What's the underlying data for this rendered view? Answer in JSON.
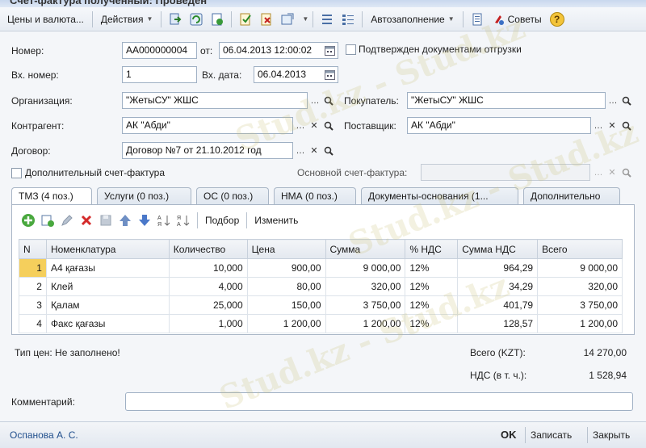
{
  "window": {
    "title": "Счет-фактура полученный: Проведен"
  },
  "toolbar": {
    "prices_label": "Цены и валюта...",
    "actions_label": "Действия",
    "autofill_label": "Автозаполнение",
    "tips_label": "Советы",
    "help_label": "?"
  },
  "form": {
    "number_label": "Номер:",
    "number_value": "АА000000004",
    "date_label": "от:",
    "date_value": "06.04.2013 12:00:02",
    "confirmed_label": "Подтвержден документами отгрузки",
    "in_number_label": "Вх. номер:",
    "in_number_value": "1",
    "in_date_label": "Вх. дата:",
    "in_date_value": "06.04.2013",
    "org_label": "Организация:",
    "org_value": "\"ЖетыСУ\" ЖШС",
    "buyer_label": "Покупатель:",
    "buyer_value": "\"ЖетыСУ\" ЖШС",
    "contractor_label": "Контрагент:",
    "contractor_value": "АК \"Абди\"",
    "supplier_label": "Поставщик:",
    "supplier_value": "АК \"Абди\"",
    "contract_label": "Договор:",
    "contract_value": "Договор №7 от 21.10.2012 год",
    "additional_label": "Дополнительный счет-фактура",
    "main_invoice_label": "Основной счет-фактура:",
    "main_invoice_value": ""
  },
  "tabs": [
    {
      "label": "ТМЗ (4 поз.)",
      "active": true
    },
    {
      "label": "Услуги (0 поз.)"
    },
    {
      "label": "ОС (0 поз.)"
    },
    {
      "label": "НМА (0 поз.)"
    },
    {
      "label": "Документы-основания (1..."
    },
    {
      "label": "Дополнительно"
    }
  ],
  "panel_toolbar": {
    "select_label": "Подбор",
    "change_label": "Изменить"
  },
  "table": {
    "headers": [
      "N",
      "Номенклатура",
      "Количество",
      "Цена",
      "Сумма",
      "% НДС",
      "Сумма НДС",
      "Всего"
    ],
    "rows": [
      [
        "1",
        "А4 қағазы",
        "10,000",
        "900,00",
        "9 000,00",
        "12%",
        "964,29",
        "9 000,00"
      ],
      [
        "2",
        "Клей",
        "4,000",
        "80,00",
        "320,00",
        "12%",
        "34,29",
        "320,00"
      ],
      [
        "3",
        "Қалам",
        "25,000",
        "150,00",
        "3 750,00",
        "12%",
        "401,79",
        "3 750,00"
      ],
      [
        "4",
        "Факс қағазы",
        "1,000",
        "1 200,00",
        "1 200,00",
        "12%",
        "128,57",
        "1 200,00"
      ]
    ]
  },
  "totals": {
    "price_type": "Тип цен: Не заполнено!",
    "total_label": "Всего (KZT):",
    "total_value": "14 270,00",
    "vat_label": "НДС (в т. ч.):",
    "vat_value": "1 528,94"
  },
  "comment": {
    "label": "Комментарий:",
    "value": ""
  },
  "status": {
    "author": "Оспанова А. С.",
    "ok_label": "OK",
    "save_label": "Записать",
    "close_label": "Закрыть"
  },
  "watermark": "Stud.kz - Stud.kz",
  "colors": {
    "selected_row": "#f5cf5c",
    "accent": "#1f4e8c"
  }
}
